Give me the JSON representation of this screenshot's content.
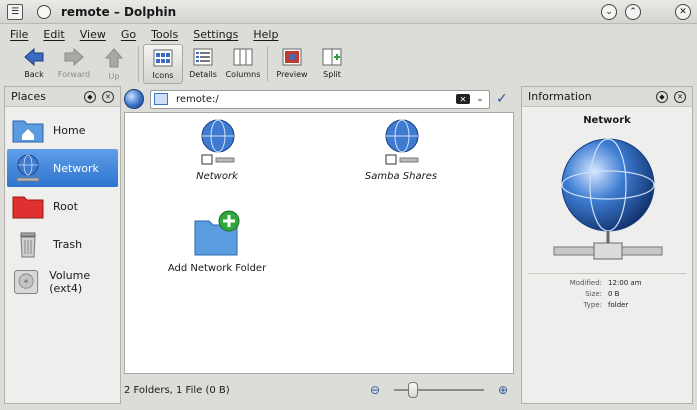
{
  "window": {
    "title": "remote – Dolphin"
  },
  "menubar": [
    "File",
    "Edit",
    "View",
    "Go",
    "Tools",
    "Settings",
    "Help"
  ],
  "toolbar": {
    "back": "Back",
    "forward": "Forward",
    "up": "Up",
    "icons": "Icons",
    "details": "Details",
    "columns": "Columns",
    "preview": "Preview",
    "split": "Split"
  },
  "places": {
    "title": "Places",
    "items": [
      {
        "label": "Home",
        "icon": "home-folder-icon"
      },
      {
        "label": "Network",
        "icon": "network-globe-icon",
        "selected": true
      },
      {
        "label": "Root",
        "icon": "root-folder-icon"
      },
      {
        "label": "Trash",
        "icon": "trash-icon"
      },
      {
        "label": "Volume (ext4)",
        "icon": "drive-icon"
      }
    ]
  },
  "location": {
    "path": "remote:/"
  },
  "files": [
    {
      "name": "Network",
      "icon": "network-globe-icon"
    },
    {
      "name": "Samba Shares",
      "icon": "network-globe-icon"
    },
    {
      "name": "Add Network Folder",
      "icon": "folder-add-icon"
    }
  ],
  "status": {
    "text": "2 Folders, 1 File (0 B)",
    "zoom_level": 0.2
  },
  "info": {
    "title": "Information",
    "name": "Network",
    "meta": [
      {
        "key": "Modified:",
        "value": "12:00 am"
      },
      {
        "key": "Size:",
        "value": "0 B"
      },
      {
        "key": "Type:",
        "value": "folder"
      }
    ]
  },
  "colors": {
    "selection": "#2d74cf",
    "accent": "#2a5a98"
  }
}
